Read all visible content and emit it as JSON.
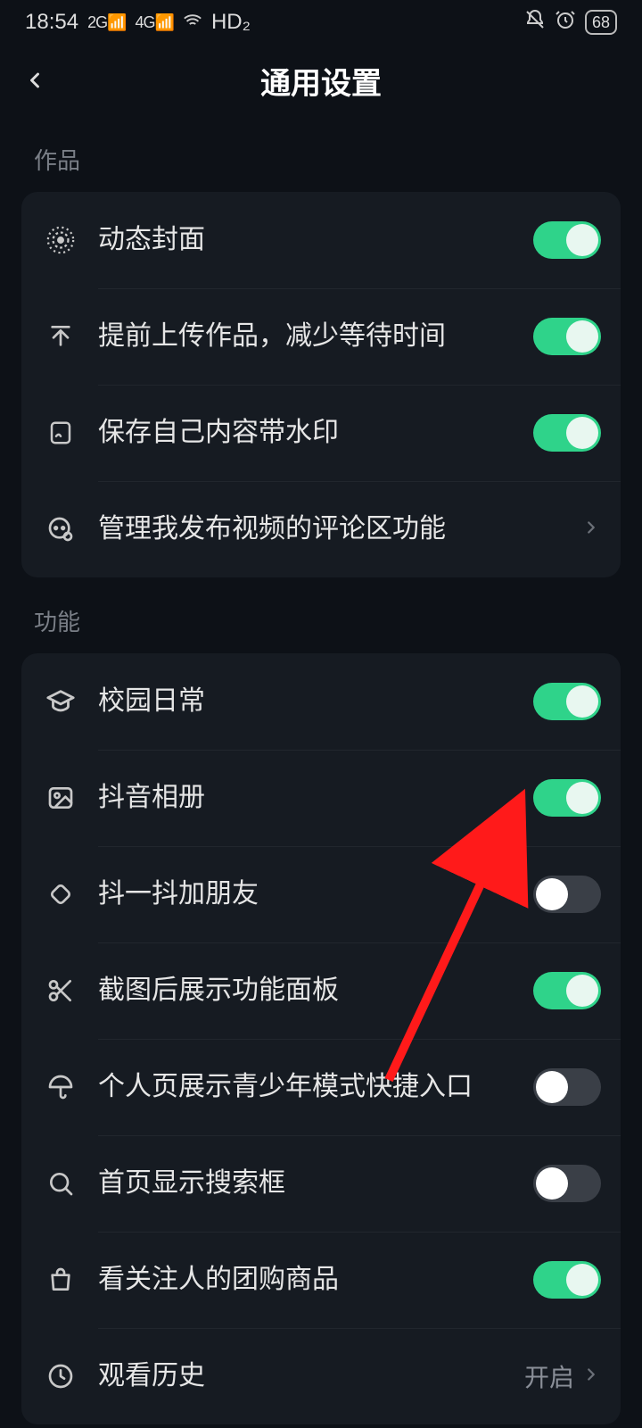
{
  "status": {
    "time": "18:54",
    "signal1": "2G",
    "signal2": "4G",
    "hd": "HD₂",
    "battery": "68"
  },
  "header": {
    "title": "通用设置"
  },
  "section_works": {
    "title": "作品",
    "items": [
      {
        "label": "动态封面",
        "toggle": true
      },
      {
        "label": "提前上传作品，减少等待时间",
        "toggle": true
      },
      {
        "label": "保存自己内容带水印",
        "toggle": true
      },
      {
        "label": "管理我发布视频的评论区功能",
        "nav": true
      }
    ]
  },
  "section_features": {
    "title": "功能",
    "items": [
      {
        "label": "校园日常",
        "toggle": true
      },
      {
        "label": "抖音相册",
        "toggle": true
      },
      {
        "label": "抖一抖加朋友",
        "toggle": false
      },
      {
        "label": "截图后展示功能面板",
        "toggle": true
      },
      {
        "label": "个人页展示青少年模式快捷入口",
        "toggle": false
      },
      {
        "label": "首页显示搜索框",
        "toggle": false
      },
      {
        "label": "看关注人的团购商品",
        "toggle": true
      },
      {
        "label": "观看历史",
        "value": "开启",
        "nav": true
      }
    ]
  }
}
